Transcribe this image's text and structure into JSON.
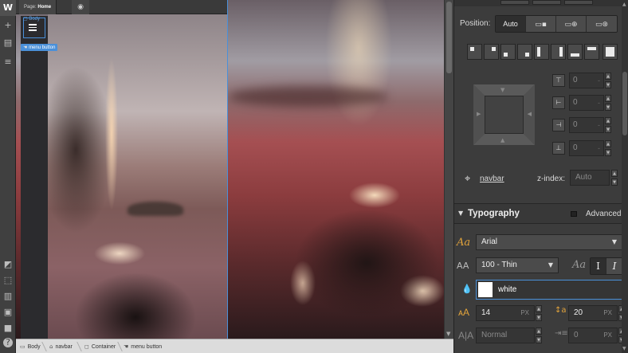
{
  "app": {
    "logo": "W"
  },
  "left_toolbar": {
    "icons": [
      "add-icon",
      "pages-icon",
      "assets-icon",
      "select-icon",
      "interactions-icon",
      "styles-icon",
      "settings-icon",
      "video-icon",
      "help-icon"
    ]
  },
  "canvas": {
    "page_prefix": "Page:",
    "page_name": "Home",
    "body_label": "Body",
    "selected_label": "menu button"
  },
  "breadcrumb": {
    "items": [
      "Body",
      "navbar",
      "Container",
      "menu button"
    ]
  },
  "position": {
    "label": "Position:",
    "auto_label": "Auto",
    "offsets": [
      "0",
      "0",
      "0",
      "0"
    ],
    "relative_to_label": "navbar",
    "zindex_label": "z-index:",
    "zindex_placeholder": "Auto"
  },
  "typography": {
    "title": "Typography",
    "advanced_label": "Advanced",
    "font_family": "Arial",
    "font_weight": "100 - Thin",
    "color_value": "white",
    "font_size": "14",
    "font_size_unit": "PX",
    "line_height": "20",
    "line_height_unit": "PX",
    "letter_spacing": "Normal",
    "text_indent": "0",
    "text_indent_unit": "PX",
    "serif_sample": "Aa",
    "normal_style": "I",
    "italic_style": "I"
  }
}
